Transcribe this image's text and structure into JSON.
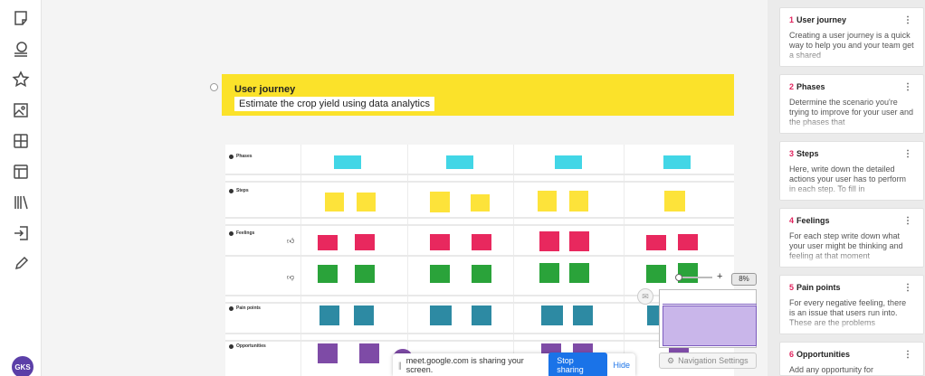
{
  "toolbar": {
    "tools": [
      "sticky-note-icon",
      "comment-icon",
      "star-icon",
      "image-icon",
      "grid-icon",
      "table-icon",
      "library-icon",
      "export-icon",
      "pen-icon"
    ],
    "avatar": "GKS"
  },
  "banner": {
    "title": "User journey",
    "subtitle": "Estimate the crop yield using data analytics"
  },
  "board": {
    "rows": [
      "Phases",
      "Steps",
      "Feelings",
      "Pain points",
      "Opportunities"
    ]
  },
  "colors": {
    "accent_yellow": "#fbe22a",
    "sticky_cyan": "#42d6e6",
    "sticky_yellow": "#fde33a",
    "sticky_pink": "#e8285e",
    "sticky_green": "#2aa33a",
    "sticky_teal": "#2d8aa3",
    "sticky_purple": "#7e4ba6",
    "card_number": "#e0245e",
    "share_button": "#1a73e8"
  },
  "zoom": {
    "plus": "+",
    "level": "8%"
  },
  "nav_settings": {
    "label": "Navigation Settings"
  },
  "share_bar": {
    "message": "meet.google.com is sharing your screen.",
    "stop_label": "Stop sharing",
    "hide_label": "Hide"
  },
  "panel": {
    "cards": [
      {
        "number": "1",
        "title": "User journey",
        "description": "Creating a user journey is a quick way to help you and your team get a shared"
      },
      {
        "number": "2",
        "title": "Phases",
        "description": "Determine the scenario you're trying to improve for your user and the phases that"
      },
      {
        "number": "3",
        "title": "Steps",
        "description": "Here, write down the detailed actions your user has to perform in each step. To fill in"
      },
      {
        "number": "4",
        "title": "Feelings",
        "description": "For each step write down what your user might be thinking and feeling at that moment"
      },
      {
        "number": "5",
        "title": "Pain points",
        "description": "For every negative feeling, there is an issue that users run into. These are the problems"
      },
      {
        "number": "6",
        "title": "Opportunities",
        "description": "Add any opportunity for improvement"
      }
    ]
  }
}
